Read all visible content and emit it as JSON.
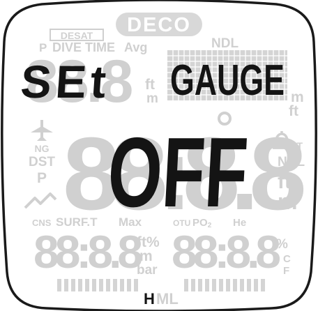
{
  "badges": {
    "deco": "DECO",
    "desat": "DESAT"
  },
  "labels": {
    "p_small": "P",
    "dive_time": "DIVE TIME",
    "avg": "Avg",
    "ndl_top": "NDL",
    "ft_upper": "ft",
    "m_upper": "m",
    "m_right": "m",
    "ft_right": "ft",
    "ng": "NG",
    "dst": "DST",
    "p_left": "P",
    "lt": "LT",
    "ndl_right": "NDL",
    "ft_big": "ft",
    "m_big": "m",
    "cns": "CNS",
    "surf_t": "SURF.T",
    "max": "Max",
    "otu": "OTU",
    "po2": "PO",
    "po2_sub": "2",
    "he": "He",
    "ft_pct": "ft%",
    "m_lower": "m",
    "bar": "bar",
    "pct_right": "%",
    "c_right": "C",
    "f_right": "F",
    "h": "H",
    "ml": "ML"
  },
  "display": {
    "set_text": "SEt",
    "mode_text": "GAUGE",
    "value_text": "OFF"
  },
  "icons": [
    "airplane-icon",
    "bell-icon",
    "zigzag-icon"
  ],
  "colors": {
    "active": "#141414",
    "inactive": "#d4d4d4",
    "bezel": "#1a1a1a"
  }
}
